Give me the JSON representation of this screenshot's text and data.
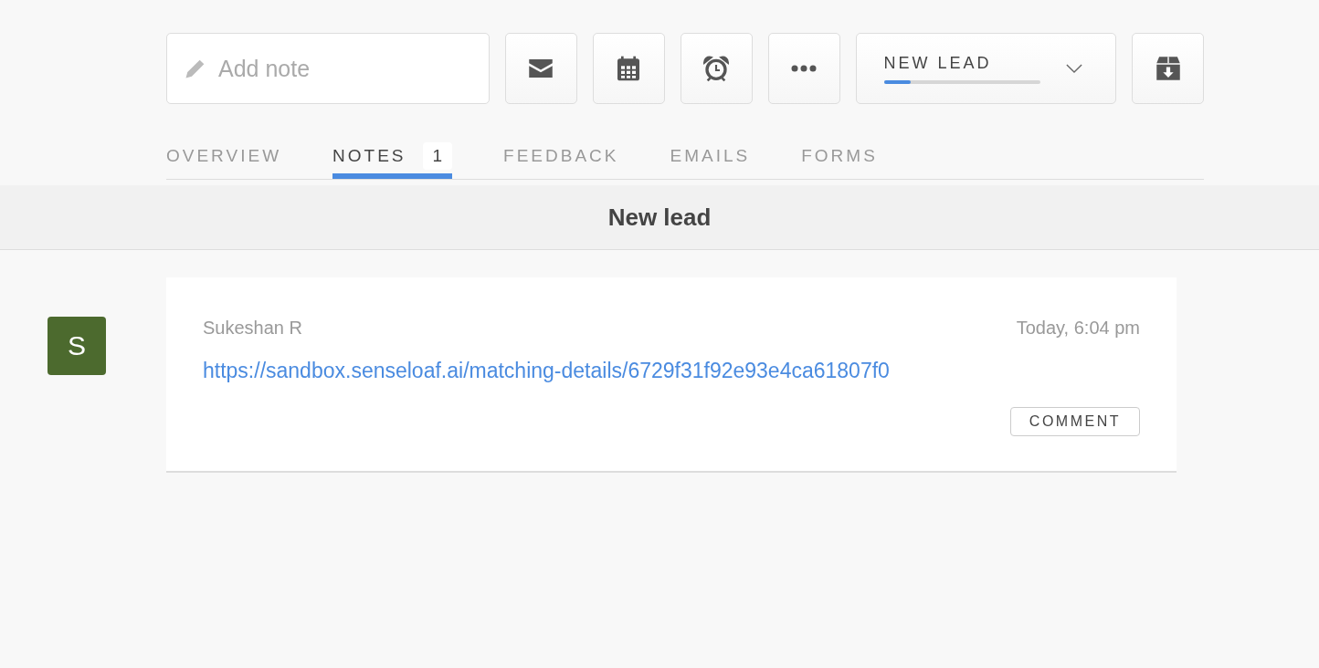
{
  "toolbar": {
    "note_field": {
      "placeholder": "Add note"
    },
    "status": {
      "label": "NEW LEAD",
      "level": 0.17
    }
  },
  "tabs": [
    {
      "label": "OVERVIEW",
      "selected": false
    },
    {
      "label": "NOTES",
      "selected": true,
      "count": "1"
    },
    {
      "label": "FEEDBACK",
      "selected": false
    },
    {
      "label": "EMAILS",
      "selected": false
    },
    {
      "label": "FORMS",
      "selected": false
    }
  ],
  "section": {
    "title": "New lead"
  },
  "notes": [
    {
      "avatar": "S",
      "author": "Sukeshan R",
      "time": "Today, 6:04 pm",
      "link": "https://sandbox.senseloaf.ai/matching-details/6729f31f92e93e4ca61807f0",
      "action": "COMMENT"
    }
  ]
}
